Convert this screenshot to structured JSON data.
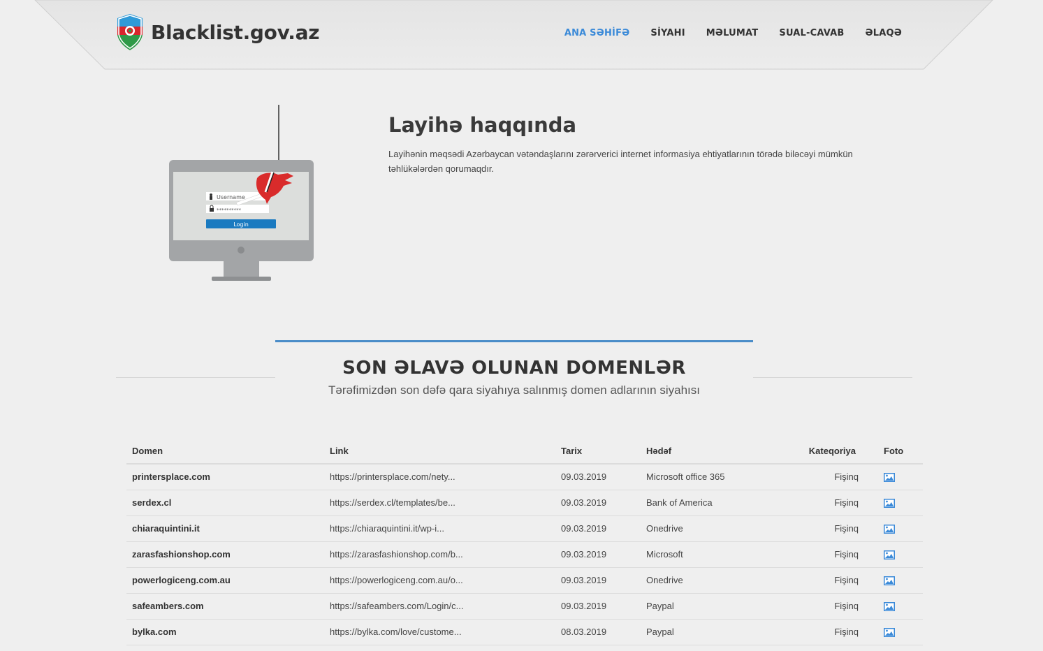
{
  "header": {
    "logo_text": "Blacklist.gov.az",
    "nav": [
      {
        "label": "ANA SƏHİFƏ",
        "active": true
      },
      {
        "label": "SİYAHI",
        "active": false
      },
      {
        "label": "MƏLUMAT",
        "active": false
      },
      {
        "label": "SUAL-CAVAB",
        "active": false
      },
      {
        "label": "ƏLAQƏ",
        "active": false
      }
    ]
  },
  "about": {
    "title": "Layihə haqqında",
    "description": "Layihənin məqsədi Azərbaycan vətəndaşlarını zərərverici internet informasiya ehtiyatlarının törədə biləcəyi mümkün təhlükələrdən qorumaqdır.",
    "illustration": {
      "username_placeholder": "Username",
      "password_mask": "**********",
      "login_label": "Login"
    }
  },
  "domains_section": {
    "title": "SON ƏLAVƏ OLUNAN DOMENLƏR",
    "subtitle": "Tərəfimizdən son dəfə qara siyahıya salınmış domen adlarının siyahısı",
    "columns": [
      "Domen",
      "Link",
      "Tarix",
      "Hədəf",
      "Kateqoriya",
      "Foto"
    ],
    "rows": [
      {
        "domain": "printersplace.com",
        "link": "https://printersplace.com/nety...",
        "date": "09.03.2019",
        "target": "Microsoft office 365",
        "category": "Fişinq"
      },
      {
        "domain": "serdex.cl",
        "link": "https://serdex.cl/templates/be...",
        "date": "09.03.2019",
        "target": "Bank of America",
        "category": "Fişinq"
      },
      {
        "domain": "chiaraquintini.it",
        "link": "https://chiaraquintini.it/wp-i...",
        "date": "09.03.2019",
        "target": "Onedrive",
        "category": "Fişinq"
      },
      {
        "domain": "zarasfashionshop.com",
        "link": "https://zarasfashionshop.com/b...",
        "date": "09.03.2019",
        "target": "Microsoft",
        "category": "Fişinq"
      },
      {
        "domain": "powerlogiceng.com.au",
        "link": "https://powerlogiceng.com.au/o...",
        "date": "09.03.2019",
        "target": "Onedrive",
        "category": "Fişinq"
      },
      {
        "domain": "safeambers.com",
        "link": "https://safeambers.com/Login/c...",
        "date": "09.03.2019",
        "target": "Paypal",
        "category": "Fişinq"
      },
      {
        "domain": "bylka.com",
        "link": "https://bylka.com/love/custome...",
        "date": "08.03.2019",
        "target": "Paypal",
        "category": "Fişinq"
      }
    ],
    "photo_icon": "image-icon"
  },
  "colors": {
    "accent": "#3b8ad8",
    "section_line": "#4a8cc8",
    "background": "#efefef",
    "header_bg": "#e8e8e8"
  }
}
